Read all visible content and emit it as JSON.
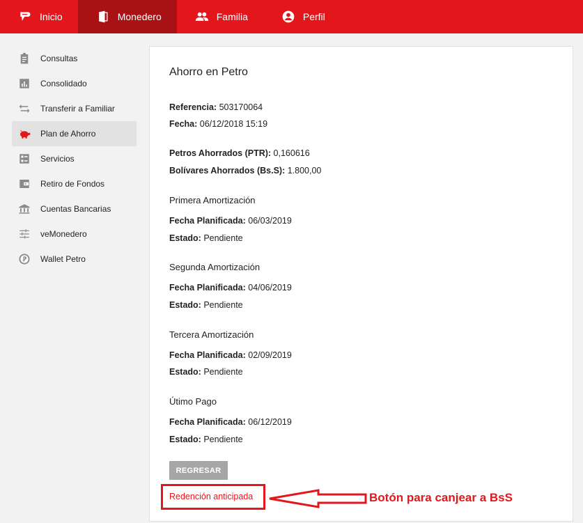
{
  "topnav": {
    "items": [
      {
        "label": "Inicio",
        "icon": "logo-icon"
      },
      {
        "label": "Monedero",
        "icon": "wallet-icon"
      },
      {
        "label": "Familia",
        "icon": "family-icon"
      },
      {
        "label": "Perfil",
        "icon": "profile-icon"
      }
    ],
    "active_index": 1
  },
  "sidebar": {
    "items": [
      {
        "label": "Consultas",
        "icon": "clipboard-icon"
      },
      {
        "label": "Consolidado",
        "icon": "bar-chart-icon"
      },
      {
        "label": "Transferir a Familiar",
        "icon": "swap-arrows-icon"
      },
      {
        "label": "Plan de Ahorro",
        "icon": "piggy-bank-icon"
      },
      {
        "label": "Servicios",
        "icon": "services-icon"
      },
      {
        "label": "Retiro de Fondos",
        "icon": "withdraw-icon"
      },
      {
        "label": "Cuentas Bancarias",
        "icon": "bank-icon"
      },
      {
        "label": "veMonedero",
        "icon": "sliders-icon"
      },
      {
        "label": "Wallet Petro",
        "icon": "petro-coin-icon"
      }
    ],
    "active_index": 3
  },
  "card": {
    "title": "Ahorro en Petro",
    "referencia_label": "Referencia:",
    "referencia_value": " 503170064",
    "fecha_label": "Fecha:",
    "fecha_value": " 06/12/2018 15:19",
    "petros_label": "Petros Ahorrados (PTR):",
    "petros_value": " 0,160616",
    "bolivares_label": "Bolívares Ahorrados (Bs.S):",
    "bolivares_value": " 1.800,00",
    "amortizations": [
      {
        "title": "Primera Amortización",
        "fecha_label": "Fecha Planificada:",
        "fecha_value": " 06/03/2019",
        "estado_label": "Estado:",
        "estado_value": " Pendiente"
      },
      {
        "title": "Segunda Amortización",
        "fecha_label": "Fecha Planificada:",
        "fecha_value": " 04/06/2019",
        "estado_label": "Estado:",
        "estado_value": " Pendiente"
      },
      {
        "title": "Tercera Amortización",
        "fecha_label": "Fecha Planificada:",
        "fecha_value": " 02/09/2019",
        "estado_label": "Estado:",
        "estado_value": " Pendiente"
      },
      {
        "title": "Útimo Pago",
        "fecha_label": "Fecha Planificada:",
        "fecha_value": " 06/12/2019",
        "estado_label": "Estado:",
        "estado_value": " Pendiente"
      }
    ],
    "back_button": "REGRESAR",
    "early_redemption": "Redención anticipada"
  },
  "annotation": {
    "text": "Botón para canjear a BsS",
    "color": "#e3171b"
  },
  "colors": {
    "brand_red": "#e3171b",
    "nav_active": "#a91115",
    "button_gray": "#a6a6a6"
  }
}
